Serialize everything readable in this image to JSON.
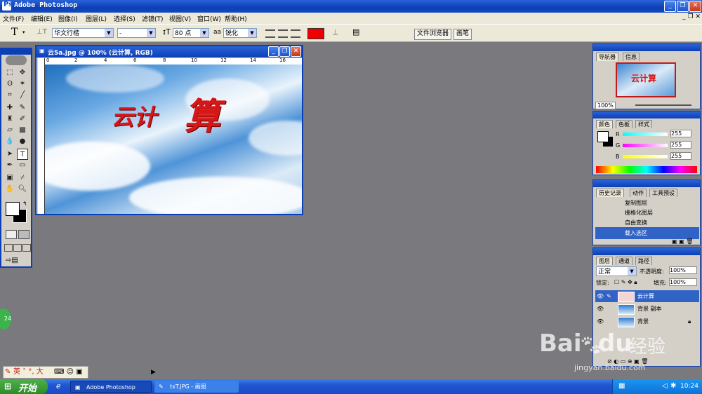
{
  "app": {
    "title": "Adobe Photoshop"
  },
  "menu": [
    "文件(F)",
    "编辑(E)",
    "图像(I)",
    "图层(L)",
    "选择(S)",
    "滤镜(T)",
    "视图(V)",
    "窗口(W)",
    "帮助(H)"
  ],
  "options": {
    "tool_glyph": "T",
    "font_family": "华文行楷",
    "font_style": "-",
    "font_size": "80 点",
    "aa_label": "aa",
    "antialias": "锐化",
    "color_hex": "#ee0000",
    "file_browser_tab": "文件浏览器",
    "brushes_tab": "画笔"
  },
  "document": {
    "title": "云5a.jpg @ 100% (云计算, RGB)",
    "ruler_labels": [
      "0",
      "2",
      "4",
      "6",
      "8",
      "10",
      "12",
      "14",
      "16"
    ],
    "art_text_1": "云计",
    "art_text_2": "算"
  },
  "navigator": {
    "tabs": [
      "导航器",
      "信息"
    ],
    "zoom": "100%",
    "thumb_text": "云计算"
  },
  "color_panel": {
    "tabs": [
      "颜色",
      "色板",
      "样式"
    ],
    "channels": [
      {
        "label": "R",
        "value": "255"
      },
      {
        "label": "G",
        "value": "255"
      },
      {
        "label": "B",
        "value": "255"
      }
    ]
  },
  "history": {
    "tabs": [
      "历史记录",
      "动作",
      "工具预设"
    ],
    "items": [
      "复制图层",
      "栅格化图层",
      "自由变换",
      "载入选区"
    ]
  },
  "layers": {
    "tabs": [
      "图层",
      "通道",
      "路径"
    ],
    "blend_mode": "正常",
    "opacity_label": "不透明度:",
    "opacity": "100%",
    "lock_label": "锁定:",
    "fill_label": "填充:",
    "fill": "100%",
    "items": [
      "云计算",
      "背景 副本",
      "背景"
    ]
  },
  "ime_bar": {
    "text": "英 ˃ °, 大"
  },
  "taskbar": {
    "start_label": "开始",
    "tasks": [
      "Adobe Photoshop",
      "txT.JPG - 画图"
    ],
    "clock": "10:24",
    "badge": "24"
  },
  "watermark": {
    "brand": "Bai",
    "brand2": "du",
    "cn": "经验",
    "url": "jingyan.baidu.com"
  }
}
